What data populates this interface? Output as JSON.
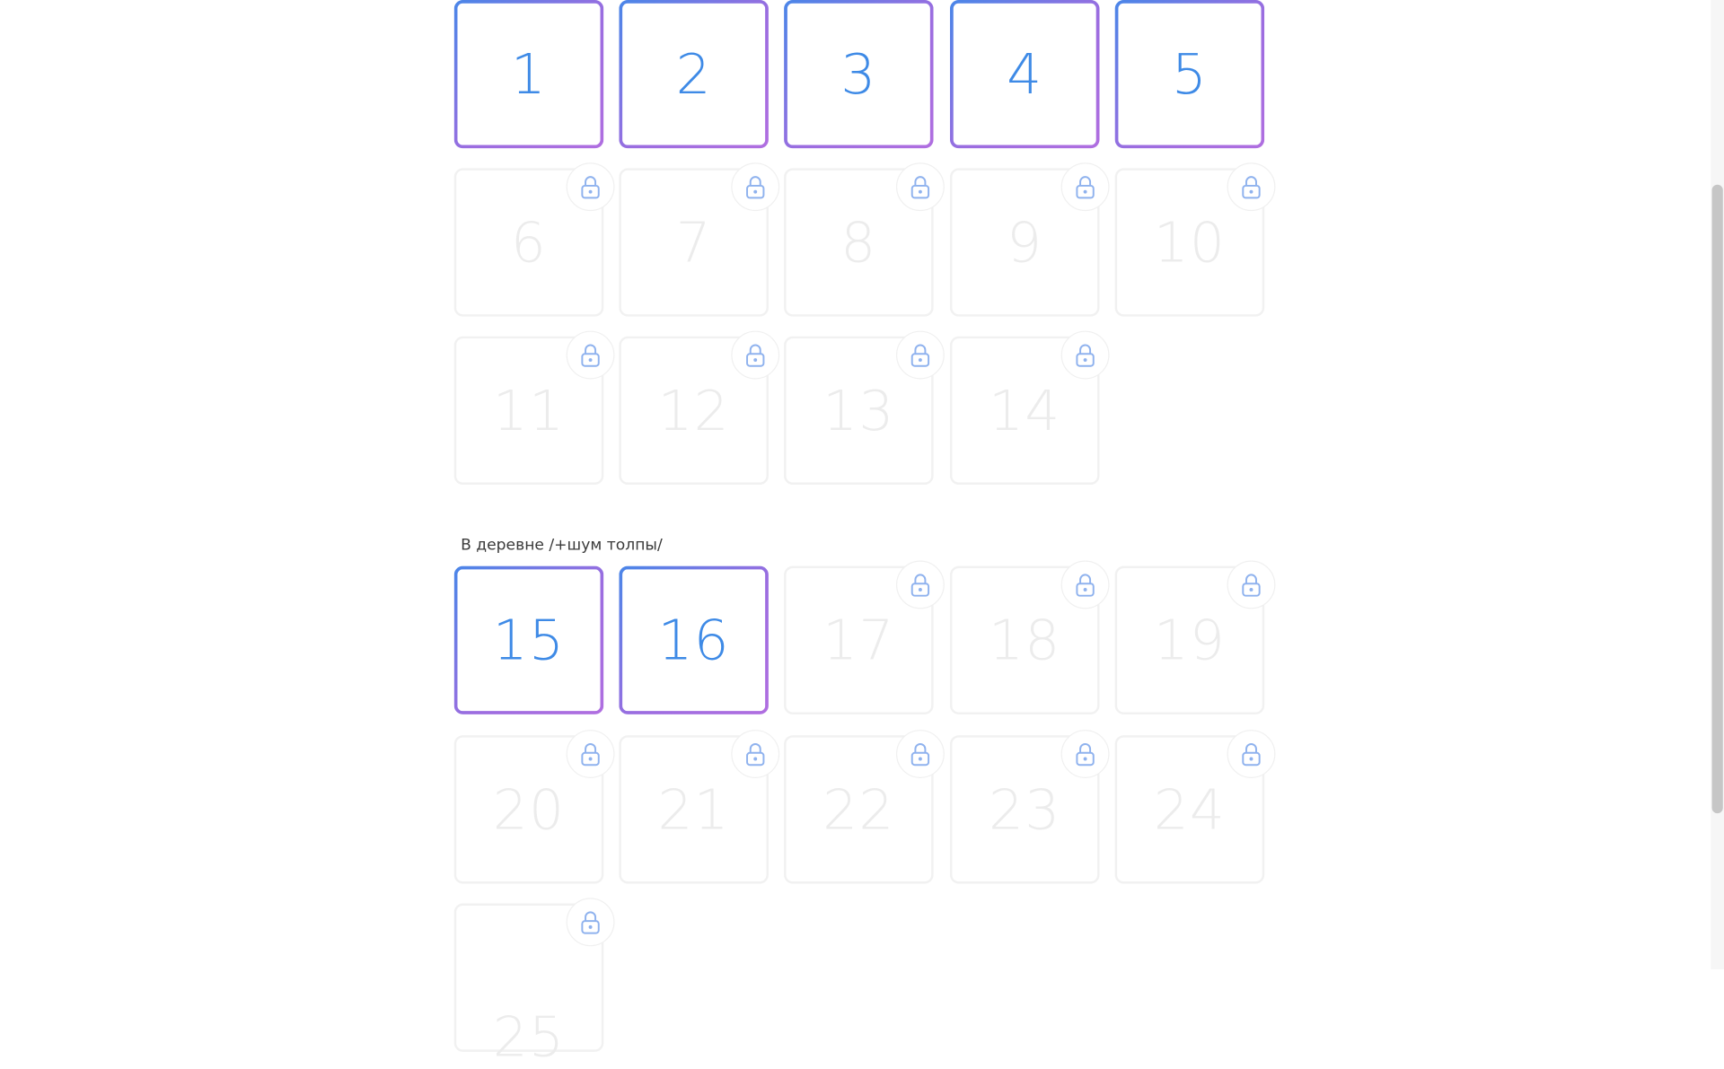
{
  "groups": [
    {
      "label": "",
      "tiles": [
        {
          "number": "1",
          "locked": false
        },
        {
          "number": "2",
          "locked": false
        },
        {
          "number": "3",
          "locked": false
        },
        {
          "number": "4",
          "locked": false
        },
        {
          "number": "5",
          "locked": false
        },
        {
          "number": "6",
          "locked": true
        },
        {
          "number": "7",
          "locked": true
        },
        {
          "number": "8",
          "locked": true
        },
        {
          "number": "9",
          "locked": true
        },
        {
          "number": "10",
          "locked": true
        },
        {
          "number": "11",
          "locked": true
        },
        {
          "number": "12",
          "locked": true
        },
        {
          "number": "13",
          "locked": true
        },
        {
          "number": "14",
          "locked": true
        }
      ]
    },
    {
      "label": "В деревне /+шум толпы/",
      "tiles": [
        {
          "number": "15",
          "locked": false
        },
        {
          "number": "16",
          "locked": false
        },
        {
          "number": "17",
          "locked": true
        },
        {
          "number": "18",
          "locked": true
        },
        {
          "number": "19",
          "locked": true
        },
        {
          "number": "20",
          "locked": true
        },
        {
          "number": "21",
          "locked": true
        },
        {
          "number": "22",
          "locked": true
        },
        {
          "number": "23",
          "locked": true
        },
        {
          "number": "24",
          "locked": true
        },
        {
          "number": "25",
          "locked": true
        }
      ]
    }
  ],
  "icons": {
    "lock": "lock-icon"
  },
  "colors": {
    "accent_blue": "#3e8ae6",
    "border_gradient_start": "#4a86e8",
    "border_gradient_end": "#b06ee0",
    "locked_number": "#ececec",
    "lock_icon": "#8fb2ee"
  }
}
